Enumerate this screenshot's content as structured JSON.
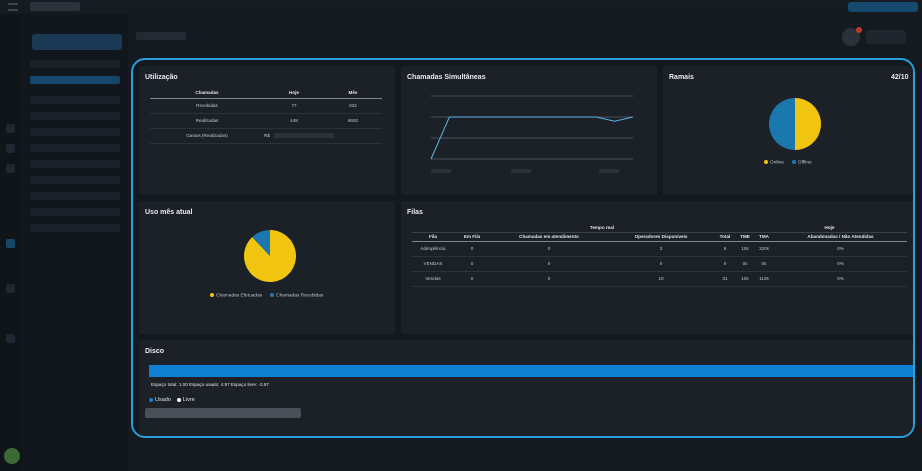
{
  "utilizacao": {
    "title": "Utilização",
    "headers": [
      "Chamadas",
      "Hoje",
      "Mês"
    ],
    "rows": [
      {
        "label": "Recebidas",
        "hoje": "77",
        "mes": "932"
      },
      {
        "label": "Realizadas",
        "hoje": "448",
        "mes": "6692"
      },
      {
        "label": "Gastos (Realizadas)",
        "hoje": "R$",
        "mes": ""
      }
    ]
  },
  "simultaneas": {
    "title": "Chamadas Simultâneas",
    "chart_data": {
      "type": "line",
      "series": [
        {
          "values": [
            0.0,
            1.0,
            1.0,
            1.0,
            1.0,
            1.0,
            1.0,
            1.0,
            1.0,
            1.0,
            0.9,
            1.0
          ]
        }
      ],
      "ylim": [
        0,
        1.5
      ],
      "grid": true,
      "line_color": "#5ab4e6"
    }
  },
  "ramais": {
    "title": "Ramais",
    "count": "42/10",
    "chart_data": {
      "type": "pie",
      "labels": [
        "Online",
        "Offline"
      ],
      "values": [
        50,
        50
      ],
      "colors": [
        "#f1c40f",
        "#1b78ad"
      ]
    }
  },
  "uso_mes": {
    "title": "Uso mês atual",
    "chart_data": {
      "type": "pie",
      "labels": [
        "Chamadas Efetuadas",
        "Chamadas Recebidas"
      ],
      "values": [
        88,
        12
      ],
      "colors": [
        "#f1c40f",
        "#1b78ad"
      ]
    }
  },
  "filas": {
    "title": "Filas",
    "group_tempo_real": "Tempo real",
    "group_hoje": "Hoje",
    "headers": [
      "Fila",
      "Em Fila",
      "Chamadas em atendimento",
      "Operadores Disponíveis",
      "Total",
      "TME",
      "TMA",
      "Abandonadas / Não Atendidas"
    ],
    "rows": [
      [
        "Adimplência",
        "0",
        "0",
        "3",
        "8",
        "10s",
        "320s",
        "0%"
      ],
      [
        "VENDAS",
        "0",
        "0",
        "0",
        "0",
        "0s",
        "0s",
        "0%"
      ],
      [
        "Vendas",
        "0",
        "0",
        "10",
        "31",
        "10s",
        "113s",
        "0%"
      ]
    ]
  },
  "disco": {
    "title": "Disco",
    "info": "Espaço total: 1.00   Espaço usado: 4.97   Espaço livre: -3.97",
    "used_fraction": 1.0,
    "legend_used": "Usado",
    "legend_free": "Livre",
    "used_color": "#1080d2",
    "free_color": "#ffffff"
  }
}
